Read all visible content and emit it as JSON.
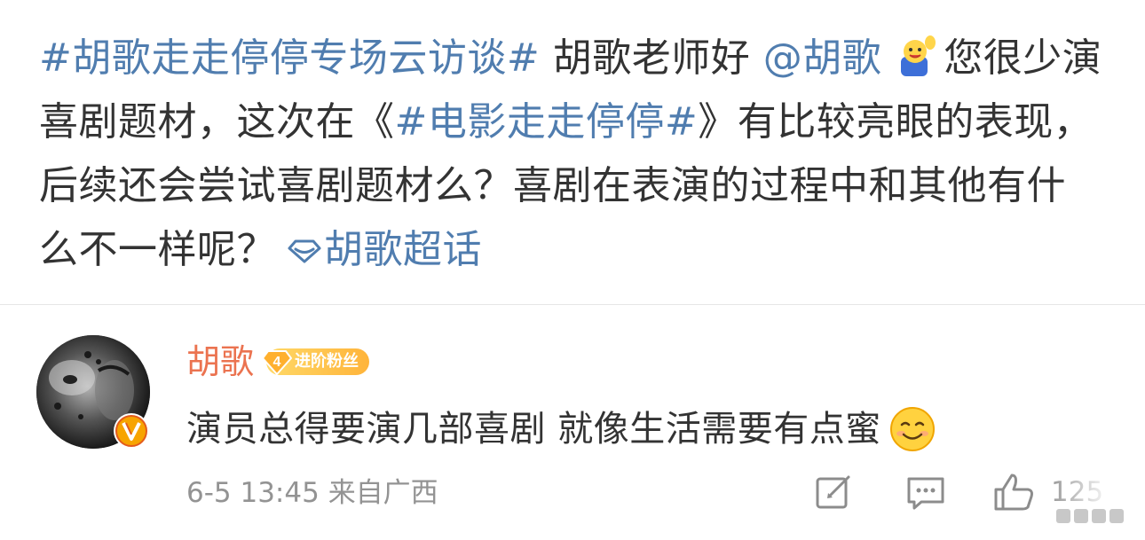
{
  "post": {
    "topic_tag": "#胡歌走走停停专场云访谈#",
    "greeting": " 胡歌老师好",
    "mention": "@胡歌",
    "text_1": "您很少演喜剧题材，这次在《",
    "movie_tag": "#电影走走停停#",
    "text_2": "》有比较亮眼的表现，后续还会尝试喜剧题材么？喜剧在表演的过程中和其他有什么不一样呢？",
    "chaohua_link": "胡歌超话",
    "emoji_icon": "wave-hand-emoji-icon",
    "chaohua_icon": "diamond-icon"
  },
  "comment": {
    "author": "胡歌",
    "fan_badge": {
      "level": "4",
      "label": "进阶粉丝"
    },
    "text": "演员总得要演几部喜剧 就像生活需要有点蜜",
    "emoji": "smile-emoji-icon",
    "date": "6-5 13:45",
    "location": "来自广西",
    "like_count": "125"
  },
  "colors": {
    "link": "#507daf",
    "author": "#eb7350",
    "meta": "#939393",
    "badge": "#ffc24a"
  }
}
